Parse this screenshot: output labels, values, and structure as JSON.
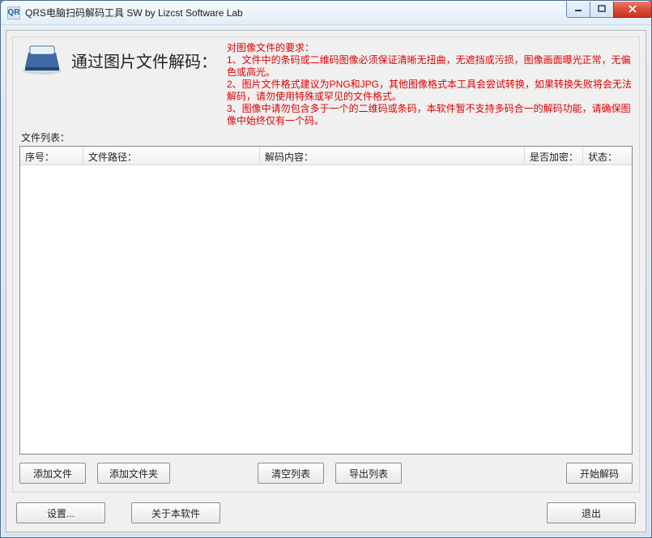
{
  "window": {
    "title": "QRS电脑扫码解码工具 SW  by Lizcst Software Lab"
  },
  "header": {
    "heading": "通过图片文件解码：",
    "requirements_title": "对图像文件的要求：",
    "req1": "1、文件中的条码或二维码图像必须保证清晰无扭曲，无遮挡或污损，图像画面曝光正常，无偏色或高光。",
    "req2": "2、图片文件格式建议为PNG和JPG，其他图像格式本工具会尝试转换，如果转换失败将会无法解码，请勿使用特殊或罕见的文件格式。",
    "req3": "3、图像中请勿包含多于一个的二维码或条码，本软件暂不支持多码合一的解码功能，请确保图像中始终仅有一个码。"
  },
  "list": {
    "label": "文件列表：",
    "columns": {
      "index": "序号：",
      "path": "文件路径：",
      "content": "解码内容：",
      "encrypted": "是否加密：",
      "status": "状态："
    }
  },
  "buttons": {
    "add_file": "添加文件",
    "add_folder": "添加文件夹",
    "clear_list": "清空列表",
    "export_list": "导出列表",
    "start_decode": "开始解码",
    "settings": "设置...",
    "about": "关于本软件",
    "exit": "退出"
  }
}
